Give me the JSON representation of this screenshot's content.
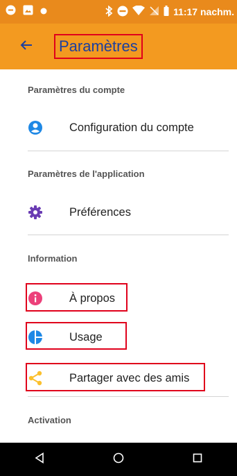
{
  "status_bar": {
    "time": "11:17 nachm.",
    "icons": [
      "record-icon",
      "image-icon",
      "dot-icon",
      "bluetooth-icon",
      "do-not-disturb-icon",
      "wifi-icon",
      "no-signal-icon",
      "battery-icon"
    ]
  },
  "app_bar": {
    "back_icon": "arrow-back-icon",
    "title": "Paramètres",
    "background": "#f39a20"
  },
  "sections": [
    {
      "header": "Paramètres du compte",
      "items": [
        {
          "label": "Configuration du compte",
          "icon": "account-circle-icon",
          "icon_color": "#1e88e5"
        }
      ]
    },
    {
      "header": "Paramètres de l'application",
      "items": [
        {
          "label": "Préférences",
          "icon": "gear-icon",
          "icon_color": "#6a3cb3"
        }
      ]
    },
    {
      "header": "Information",
      "items": [
        {
          "label": "À propos",
          "icon": "info-icon",
          "icon_color": "#ec407a"
        },
        {
          "label": "Usage",
          "icon": "usage-icon",
          "icon_color": "#1e88e5"
        },
        {
          "label": "Partager avec des amis",
          "icon": "share-icon",
          "icon_color": "#fbc02d"
        }
      ]
    },
    {
      "header": "Activation",
      "items": []
    }
  ],
  "nav_bar": {
    "icons": [
      "back-triangle-icon",
      "home-circle-icon",
      "recents-square-icon"
    ]
  }
}
